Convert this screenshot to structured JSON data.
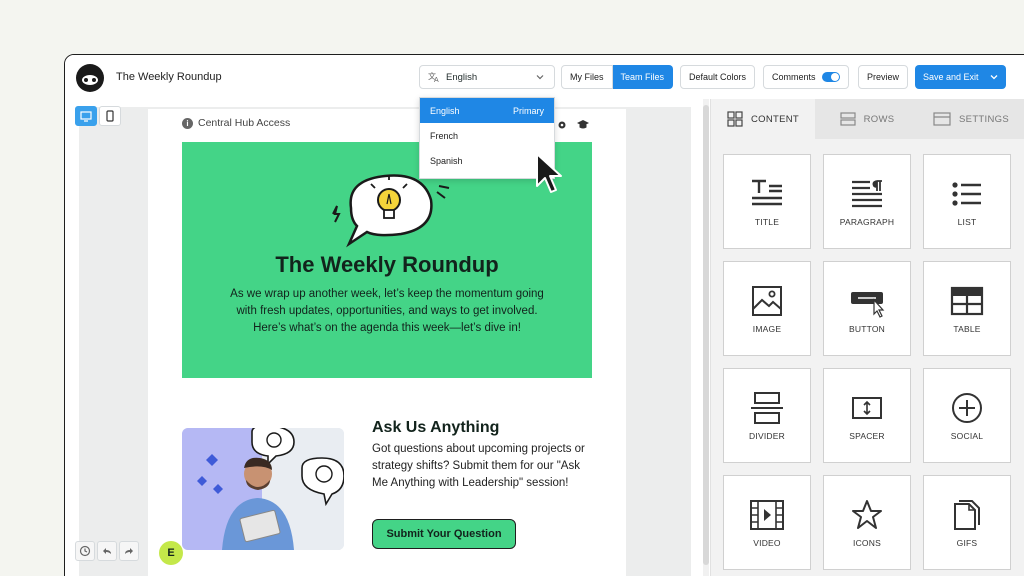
{
  "header": {
    "title": "The Weekly Roundup",
    "language": "English",
    "my_files": "My Files",
    "team_files": "Team Files",
    "default_colors": "Default Colors",
    "comments": "Comments",
    "preview": "Preview",
    "save_exit": "Save and Exit"
  },
  "language_menu": {
    "items": [
      {
        "label": "English",
        "badge": "Primary"
      },
      {
        "label": "French"
      },
      {
        "label": "Spanish"
      }
    ]
  },
  "email": {
    "top_text": "Central Hub Access",
    "hero_title": "The Weekly Roundup",
    "hero_body": "As we wrap up another week, let’s keep the momentum going with fresh updates, opportunities, and ways to get involved. Here’s what’s on the agenda this week—let’s dive in!",
    "ask_title": "Ask Us Anything",
    "ask_body": "Got questions about upcoming projects or strategy shifts? Submit them for our \"Ask Me Anything with Leadership\" session!",
    "ask_button": "Submit Your Question"
  },
  "avatar_initial": "E",
  "panel": {
    "tabs": [
      "CONTENT",
      "ROWS",
      "SETTINGS"
    ],
    "tiles": [
      "TITLE",
      "PARAGRAPH",
      "LIST",
      "IMAGE",
      "BUTTON",
      "TABLE",
      "DIVIDER",
      "SPACER",
      "SOCIAL",
      "VIDEO",
      "ICONS",
      "GIFS"
    ]
  },
  "colors": {
    "accent": "#1f87e5",
    "hero_green": "#44d487",
    "avatar": "#c4e84a"
  }
}
